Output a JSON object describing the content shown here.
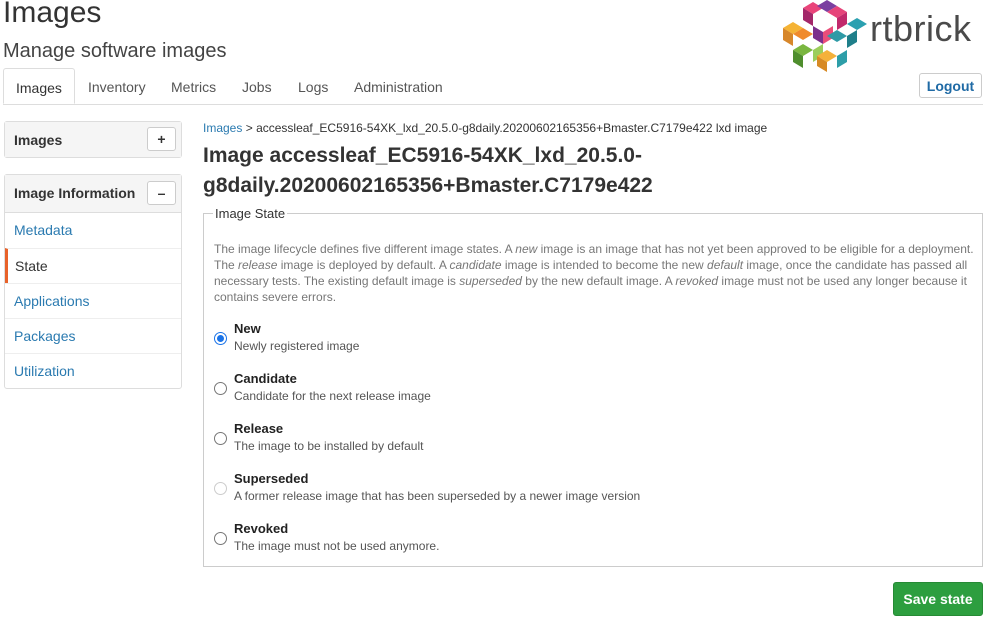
{
  "header": {
    "title": "Images",
    "subtitle": "Manage software images",
    "logo_text": "rtbrick"
  },
  "tabs": [
    {
      "label": "Images",
      "active": true
    },
    {
      "label": "Inventory"
    },
    {
      "label": "Metrics"
    },
    {
      "label": "Jobs"
    },
    {
      "label": "Logs"
    },
    {
      "label": "Administration"
    }
  ],
  "logout_label": "Logout",
  "sidebar": {
    "images_panel": {
      "title": "Images",
      "button": "+"
    },
    "info_panel": {
      "title": "Image Information",
      "button": "–",
      "items": [
        "Metadata",
        "State",
        "Applications",
        "Packages",
        "Utilization"
      ],
      "active_item": "State"
    }
  },
  "breadcrumb": {
    "link": "Images",
    "separator": ">",
    "current": "accessleaf_EC5916-54XK_lxd_20.5.0-g8daily.20200602165356+Bmaster.C7179e422 lxd image"
  },
  "page_title": "Image accessleaf_EC5916-54XK_lxd_20.5.0-g8daily.20200602165356+Bmaster.C7179e422",
  "state_form": {
    "legend": "Image State",
    "description": {
      "p1": "The image lifecycle defines five different image states. A ",
      "e1": "new",
      "p2": " image is an image that has not yet been approved to be eligible for a deployment. The ",
      "e2": "release",
      "p3": " image is deployed by default. A ",
      "e3": "candidate",
      "p4": " image is intended to become the new ",
      "e4": "default",
      "p5": " image, once the candidate has passed all necessary tests. The existing default image is ",
      "e5": "superseded",
      "p6": " by the new default image. A ",
      "e6": "revoked",
      "p7": " image must not be used any longer because it contains severe errors."
    },
    "options": [
      {
        "title": "New",
        "subtitle": "Newly registered image",
        "checked": true
      },
      {
        "title": "Candidate",
        "subtitle": "Candidate for the next release image"
      },
      {
        "title": "Release",
        "subtitle": "The image to be installed by default"
      },
      {
        "title": "Superseded",
        "subtitle": "A former release image that has been superseded by a newer image version",
        "disabled": true
      },
      {
        "title": "Revoked",
        "subtitle": "The image must not be used anymore."
      }
    ],
    "save_label": "Save state"
  },
  "colors": {
    "link": "#2a7ab0",
    "active_marker": "#e8622a",
    "save_button": "#2d9e3f",
    "radio_checked": "#1a73e8"
  }
}
